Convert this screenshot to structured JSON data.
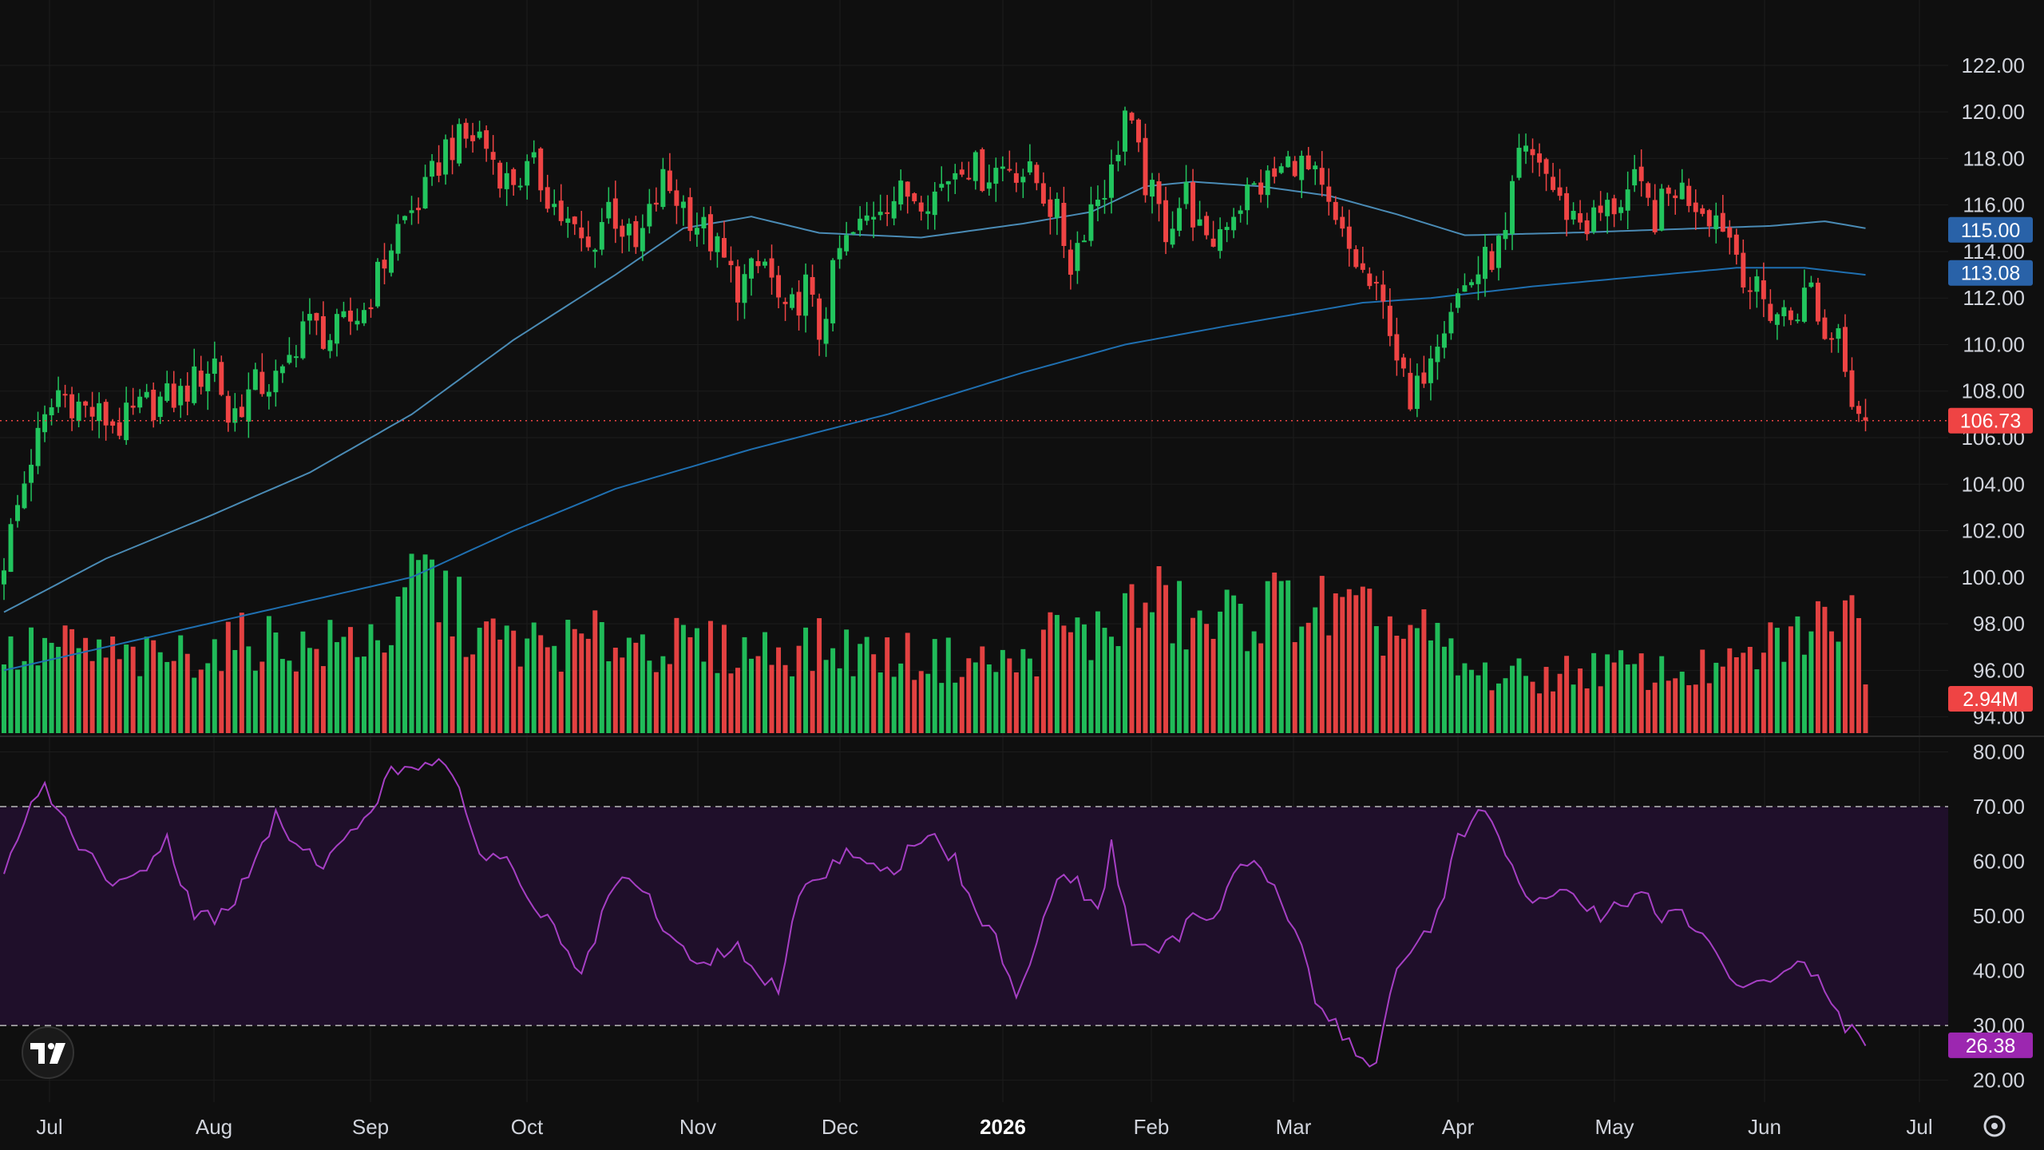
{
  "chart_data": {
    "type": "candlestick",
    "price_axis": {
      "ticks": [
        "122.00",
        "120.00",
        "118.00",
        "116.00",
        "114.00",
        "112.00",
        "110.00",
        "108.00",
        "106.00",
        "104.00",
        "102.00",
        "100.00",
        "98.00",
        "96.00",
        "94.00"
      ],
      "range": [
        93.3,
        123.3
      ]
    },
    "x_axis": {
      "labels": [
        {
          "text": "Jul",
          "bold": false
        },
        {
          "text": "Aug",
          "bold": false
        },
        {
          "text": "Sep",
          "bold": false
        },
        {
          "text": "Oct",
          "bold": false
        },
        {
          "text": "Nov",
          "bold": false
        },
        {
          "text": "Dec",
          "bold": false
        },
        {
          "text": "2026",
          "bold": true
        },
        {
          "text": "Feb",
          "bold": false
        },
        {
          "text": "Mar",
          "bold": false
        },
        {
          "text": "Apr",
          "bold": false
        },
        {
          "text": "May",
          "bold": false
        },
        {
          "text": "Jun",
          "bold": false
        },
        {
          "text": "Jul",
          "bold": false
        }
      ]
    },
    "price_path": [
      [
        0,
        100.8
      ],
      [
        4,
        105.2
      ],
      [
        8,
        108.0
      ],
      [
        12,
        107.2
      ],
      [
        17,
        106.5
      ],
      [
        21,
        107.4
      ],
      [
        26,
        107.8
      ],
      [
        31,
        109.3
      ],
      [
        33,
        106.8
      ],
      [
        37,
        108.2
      ],
      [
        41,
        108.5
      ],
      [
        44,
        111.0
      ],
      [
        48,
        110.3
      ],
      [
        53,
        111.5
      ],
      [
        58,
        115.0
      ],
      [
        62,
        116.5
      ],
      [
        65,
        118.5
      ],
      [
        70,
        119.0
      ],
      [
        74,
        117.0
      ],
      [
        78,
        117.5
      ],
      [
        82,
        115.5
      ],
      [
        86,
        114.0
      ],
      [
        89,
        116.0
      ],
      [
        93,
        114.0
      ],
      [
        97,
        117.0
      ],
      [
        100,
        116.0
      ],
      [
        104,
        114.5
      ],
      [
        108,
        112.5
      ],
      [
        112,
        113.5
      ],
      [
        115,
        111.0
      ],
      [
        118,
        112.5
      ],
      [
        120,
        110.5
      ],
      [
        123,
        114.0
      ],
      [
        126,
        115.0
      ],
      [
        129,
        116.2
      ],
      [
        133,
        116.5
      ],
      [
        137,
        116.5
      ],
      [
        141,
        118.0
      ],
      [
        144,
        117.3
      ],
      [
        148,
        117.8
      ],
      [
        152,
        117.0
      ],
      [
        155,
        115.5
      ],
      [
        157,
        113.5
      ],
      [
        160,
        116.0
      ],
      [
        163,
        117.3
      ],
      [
        165,
        120.0
      ],
      [
        168,
        117.0
      ],
      [
        171,
        115.0
      ],
      [
        174,
        116.5
      ],
      [
        177,
        114.0
      ],
      [
        180,
        115.5
      ],
      [
        183,
        116.5
      ],
      [
        187,
        117.2
      ],
      [
        190,
        118.0
      ],
      [
        193,
        117.0
      ],
      [
        196,
        115.0
      ],
      [
        200,
        113.0
      ],
      [
        204,
        111.0
      ],
      [
        207,
        107.0
      ],
      [
        210,
        110.0
      ],
      [
        213,
        111.8
      ],
      [
        218,
        113.5
      ],
      [
        221,
        114.5
      ],
      [
        223,
        118.0
      ],
      [
        226,
        118.0
      ],
      [
        229,
        116.0
      ],
      [
        233,
        115.2
      ],
      [
        237,
        116.0
      ],
      [
        240,
        116.8
      ],
      [
        243,
        115.5
      ],
      [
        246,
        116.8
      ],
      [
        250,
        116.0
      ],
      [
        253,
        115.3
      ],
      [
        255,
        114.0
      ],
      [
        257,
        112.5
      ],
      [
        260,
        111.5
      ],
      [
        263,
        111.2
      ],
      [
        266,
        112.5
      ],
      [
        268,
        110.2
      ],
      [
        270,
        110.8
      ],
      [
        272,
        108.0
      ],
      [
        274,
        106.73
      ]
    ],
    "price_series_count": 275,
    "volume_bars_count": 275,
    "volume_ticks": [
      "2.94M"
    ],
    "volume_profile": [
      [
        0,
        0.45
      ],
      [
        8,
        0.5
      ],
      [
        20,
        0.42
      ],
      [
        30,
        0.48
      ],
      [
        38,
        0.55
      ],
      [
        45,
        0.48
      ],
      [
        58,
        0.6
      ],
      [
        61,
        0.95
      ],
      [
        70,
        0.55
      ],
      [
        80,
        0.5
      ],
      [
        90,
        0.55
      ],
      [
        100,
        0.5
      ],
      [
        110,
        0.48
      ],
      [
        120,
        0.5
      ],
      [
        130,
        0.45
      ],
      [
        140,
        0.42
      ],
      [
        150,
        0.4
      ],
      [
        155,
        0.6
      ],
      [
        160,
        0.55
      ],
      [
        165,
        0.7
      ],
      [
        170,
        0.75
      ],
      [
        176,
        0.6
      ],
      [
        185,
        0.72
      ],
      [
        190,
        0.75
      ],
      [
        200,
        0.65
      ],
      [
        210,
        0.55
      ],
      [
        215,
        0.35
      ],
      [
        225,
        0.32
      ],
      [
        235,
        0.38
      ],
      [
        245,
        0.35
      ],
      [
        255,
        0.38
      ],
      [
        262,
        0.55
      ],
      [
        268,
        0.62
      ],
      [
        272,
        0.9
      ],
      [
        274,
        0.25
      ]
    ],
    "moving_averages": [
      {
        "color": "#4a8bb5",
        "value_label": "115.00",
        "path": [
          [
            0,
            98.5
          ],
          [
            15,
            100.8
          ],
          [
            30,
            102.6
          ],
          [
            45,
            104.5
          ],
          [
            60,
            107.0
          ],
          [
            75,
            110.2
          ],
          [
            90,
            113.0
          ],
          [
            100,
            115.0
          ],
          [
            110,
            115.5
          ],
          [
            120,
            114.8
          ],
          [
            135,
            114.6
          ],
          [
            150,
            115.2
          ],
          [
            160,
            115.7
          ],
          [
            168,
            116.8
          ],
          [
            175,
            117.0
          ],
          [
            185,
            116.8
          ],
          [
            195,
            116.4
          ],
          [
            205,
            115.6
          ],
          [
            215,
            114.7
          ],
          [
            230,
            114.8
          ],
          [
            250,
            115.0
          ],
          [
            260,
            115.1
          ],
          [
            268,
            115.3
          ],
          [
            274,
            115.0
          ]
        ]
      },
      {
        "color": "#1f6fb0",
        "value_label": "113.08",
        "path": [
          [
            0,
            96.0
          ],
          [
            30,
            98.0
          ],
          [
            60,
            100.0
          ],
          [
            75,
            102.0
          ],
          [
            90,
            103.8
          ],
          [
            110,
            105.5
          ],
          [
            130,
            107.0
          ],
          [
            150,
            108.8
          ],
          [
            165,
            110.0
          ],
          [
            180,
            110.8
          ],
          [
            200,
            111.8
          ],
          [
            210,
            112.0
          ],
          [
            225,
            112.5
          ],
          [
            240,
            112.9
          ],
          [
            255,
            113.3
          ],
          [
            265,
            113.3
          ],
          [
            274,
            113.0
          ]
        ]
      }
    ],
    "last_price": "106.73",
    "last_volume": "2.94M",
    "rsi": {
      "ticks": [
        "80.00",
        "70.00",
        "60.00",
        "50.00",
        "40.00",
        "30.00",
        "20.00"
      ],
      "range": [
        16.0,
        84.6
      ],
      "overbought": 70,
      "oversold": 30,
      "last_value": "26.38",
      "path": [
        [
          0,
          57
        ],
        [
          4,
          70
        ],
        [
          6,
          74
        ],
        [
          9,
          67
        ],
        [
          13,
          60
        ],
        [
          16,
          55
        ],
        [
          20,
          58
        ],
        [
          24,
          64
        ],
        [
          28,
          50
        ],
        [
          31,
          50
        ],
        [
          34,
          53
        ],
        [
          37,
          60
        ],
        [
          40,
          68
        ],
        [
          44,
          62
        ],
        [
          47,
          60
        ],
        [
          50,
          63
        ],
        [
          54,
          70
        ],
        [
          57,
          76
        ],
        [
          61,
          78
        ],
        [
          64,
          79
        ],
        [
          67,
          72
        ],
        [
          70,
          62
        ],
        [
          74,
          60
        ],
        [
          78,
          52
        ],
        [
          82,
          46
        ],
        [
          85,
          38
        ],
        [
          88,
          50
        ],
        [
          91,
          57
        ],
        [
          95,
          53
        ],
        [
          98,
          46
        ],
        [
          101,
          42
        ],
        [
          104,
          42
        ],
        [
          108,
          45
        ],
        [
          111,
          38
        ],
        [
          114,
          37
        ],
        [
          117,
          55
        ],
        [
          121,
          58
        ],
        [
          124,
          62
        ],
        [
          128,
          60
        ],
        [
          131,
          57
        ],
        [
          134,
          64
        ],
        [
          137,
          64
        ],
        [
          140,
          60
        ],
        [
          143,
          50
        ],
        [
          146,
          46
        ],
        [
          149,
          36
        ],
        [
          152,
          45
        ],
        [
          155,
          58
        ],
        [
          158,
          56
        ],
        [
          161,
          50
        ],
        [
          163,
          63
        ],
        [
          166,
          45
        ],
        [
          169,
          43
        ],
        [
          172,
          45
        ],
        [
          175,
          50
        ],
        [
          178,
          50
        ],
        [
          181,
          58
        ],
        [
          184,
          60
        ],
        [
          187,
          55
        ],
        [
          190,
          48
        ],
        [
          193,
          35
        ],
        [
          196,
          30
        ],
        [
          199,
          25
        ],
        [
          202,
          23
        ],
        [
          205,
          40
        ],
        [
          208,
          45
        ],
        [
          211,
          50
        ],
        [
          214,
          64
        ],
        [
          217,
          70
        ],
        [
          220,
          65
        ],
        [
          223,
          55
        ],
        [
          226,
          52
        ],
        [
          229,
          55
        ],
        [
          232,
          52
        ],
        [
          235,
          50
        ],
        [
          238,
          52
        ],
        [
          241,
          55
        ],
        [
          244,
          50
        ],
        [
          247,
          50
        ],
        [
          250,
          47
        ],
        [
          253,
          40
        ],
        [
          256,
          36
        ],
        [
          259,
          38
        ],
        [
          262,
          40
        ],
        [
          265,
          42
        ],
        [
          268,
          36
        ],
        [
          271,
          30
        ],
        [
          274,
          26.38
        ]
      ]
    }
  }
}
